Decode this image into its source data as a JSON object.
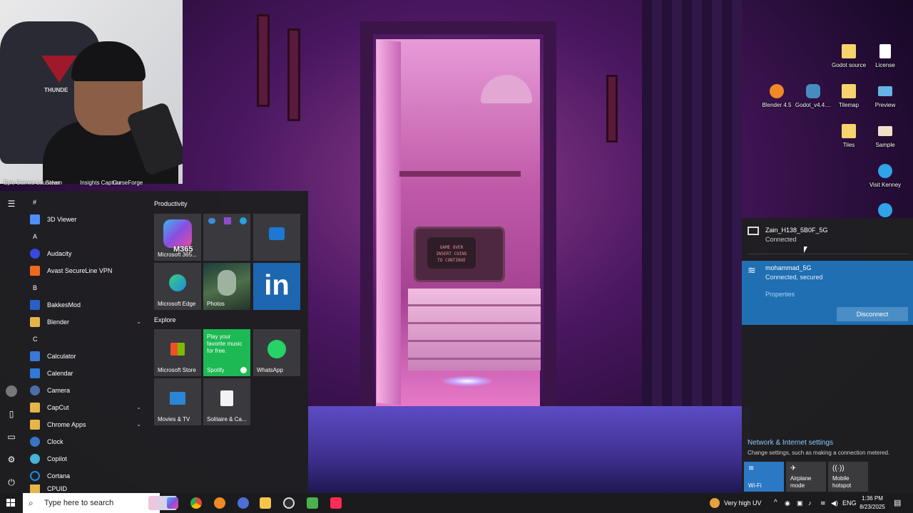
{
  "webcam": {
    "chair_brand": "THUNDE"
  },
  "desktop_labels_left": [
    "Epic Games Launcher",
    "Steam",
    "Insights Capture",
    "CurseForge"
  ],
  "desktop_icons": [
    {
      "label": "Godot source",
      "icon": "folder-icon",
      "color": "#f6d46b"
    },
    {
      "label": "License",
      "icon": "document-icon",
      "color": "#ffffff"
    },
    {
      "label": "Blender 4.5",
      "icon": "blender-icon",
      "color": "#f08a24"
    },
    {
      "label": "Godot_v4.4....",
      "icon": "godot-icon",
      "color": "#478cbf"
    },
    {
      "label": "Tilemap",
      "icon": "folder-icon",
      "color": "#f6d46b"
    },
    {
      "label": "Preview",
      "icon": "image-icon",
      "color": "#66b2e6"
    },
    {
      "label": "Tiles",
      "icon": "folder-icon",
      "color": "#f6d46b"
    },
    {
      "label": "Sample",
      "icon": "image-icon",
      "color": "#f0e0c8"
    },
    {
      "label": "Visit Kenney",
      "icon": "edge-icon",
      "color": "#2fa4e7"
    }
  ],
  "wallpaper": {
    "tv_text": "GAME OVER\nINSERT COINS\nTO CONTINUE"
  },
  "start_menu": {
    "app_list": [
      {
        "type": "header",
        "label": "#"
      },
      {
        "type": "app",
        "label": "3D Viewer",
        "icon": "cube-icon",
        "color": "#4f8ff7"
      },
      {
        "type": "header",
        "label": "A"
      },
      {
        "type": "app",
        "label": "Audacity",
        "icon": "audacity-icon",
        "color": "#3a47e0"
      },
      {
        "type": "app",
        "label": "Avast SecureLine VPN",
        "icon": "vpn-icon",
        "color": "#f06a1d"
      },
      {
        "type": "header",
        "label": "B"
      },
      {
        "type": "app",
        "label": "BakkesMod",
        "icon": "bakkesmod-icon",
        "color": "#2a5fc9"
      },
      {
        "type": "app",
        "label": "Blender",
        "icon": "folder-icon",
        "color": "#e6b54a",
        "expand": true
      },
      {
        "type": "header",
        "label": "C"
      },
      {
        "type": "app",
        "label": "Calculator",
        "icon": "calculator-icon",
        "color": "#3b78d8"
      },
      {
        "type": "app",
        "label": "Calendar",
        "icon": "calendar-icon",
        "color": "#2f7ad6"
      },
      {
        "type": "app",
        "label": "Camera",
        "icon": "camera-icon",
        "color": "#4b6ea8"
      },
      {
        "type": "app",
        "label": "CapCut",
        "icon": "folder-icon",
        "color": "#e6b54a",
        "expand": true
      },
      {
        "type": "app",
        "label": "Chrome Apps",
        "icon": "folder-icon",
        "color": "#e6b54a",
        "expand": true
      },
      {
        "type": "app",
        "label": "Clock",
        "icon": "clock-icon",
        "color": "#3a74c7"
      },
      {
        "type": "app",
        "label": "Copilot",
        "icon": "copilot-icon",
        "color": "#47b3d6"
      },
      {
        "type": "app",
        "label": "Cortana",
        "icon": "cortana-icon",
        "color": "#1c8be3"
      },
      {
        "type": "app",
        "label": "CPUID",
        "icon": "folder-icon",
        "color": "#e6b54a",
        "expand": true
      }
    ],
    "groups": {
      "productivity": "Productivity",
      "explore": "Explore"
    },
    "tiles": {
      "m365": {
        "label": "Microsoft 365...",
        "badge": "M365"
      },
      "office": {
        "label": ""
      },
      "outlook": {
        "label": ""
      },
      "edge": {
        "label": "Microsoft Edge"
      },
      "photos": {
        "label": "Photos"
      },
      "linkedin": {
        "label": "",
        "glyph": "in"
      },
      "store": {
        "label": "Microsoft Store"
      },
      "spotify": {
        "label": "Spotify",
        "promo": "Play your favorite music for free."
      },
      "whatsapp": {
        "label": "WhatsApp"
      },
      "movies": {
        "label": "Movies & TV"
      },
      "solitaire": {
        "label": "Solitaire & Ca..."
      }
    }
  },
  "network_flyout": {
    "networks": [
      {
        "name": "Zain_H138_5B0F_5G",
        "status": "Connected",
        "icon": "ethernet-monitor-icon"
      },
      {
        "name": "mohammad_5G",
        "status": "Connected, secured",
        "icon": "wifi-secured-icon",
        "properties_label": "Properties",
        "disconnect_label": "Disconnect"
      }
    ],
    "settings_title": "Network & Internet settings",
    "settings_sub": "Change settings, such as making a connection metered.",
    "quick_actions": [
      {
        "label": "Wi-Fi",
        "icon": "wifi-icon",
        "active": true
      },
      {
        "label": "Airplane mode",
        "icon": "airplane-icon",
        "active": false
      },
      {
        "label": "Mobile hotspot",
        "icon": "hotspot-icon",
        "active": false
      }
    ]
  },
  "taskbar": {
    "search_placeholder": "Type here to search",
    "weather": "Very high UV",
    "language": "ENG",
    "time": "1:36 PM",
    "date": "8/23/2025"
  }
}
